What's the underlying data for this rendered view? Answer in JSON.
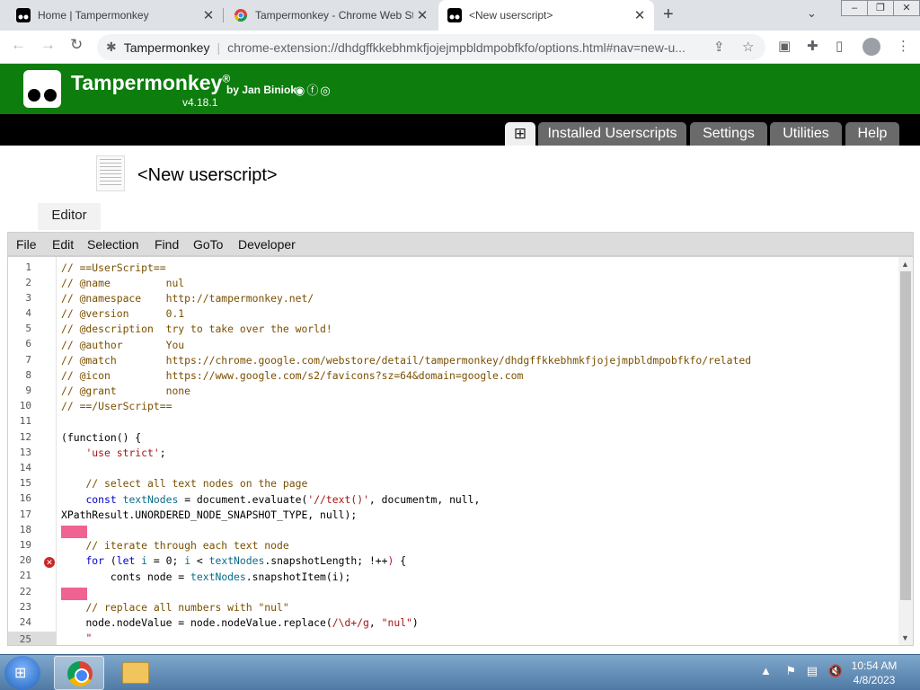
{
  "browser": {
    "tabs": [
      {
        "title": "Home | Tampermonkey",
        "active": false
      },
      {
        "title": "Tampermonkey - Chrome Web St",
        "active": false
      },
      {
        "title": "<New userscript>",
        "active": true
      }
    ],
    "site_name": "Tampermonkey",
    "url": "chrome-extension://dhdgffkkebhmkfjojejmpbldmpobfkfo/options.html#nav=new-u..."
  },
  "tm": {
    "name": "Tampermonkey",
    "reg": "®",
    "by": "by Jan Biniok",
    "version": "v4.18.1",
    "nav": {
      "add_icon": "⊞",
      "installed": "Installed Userscripts",
      "settings": "Settings",
      "utilities": "Utilities",
      "help": "Help"
    }
  },
  "script": {
    "title": "<New userscript>",
    "editor_tab": "Editor"
  },
  "menu": [
    "File",
    "Edit",
    "Selection",
    "Find",
    "GoTo",
    "Developer"
  ],
  "code": {
    "line_numbers": [
      "1",
      "2",
      "3",
      "4",
      "5",
      "6",
      "7",
      "8",
      "9",
      "10",
      "11",
      "12",
      "13",
      "14",
      "15",
      "16",
      "17",
      "18",
      "19",
      "20",
      "21",
      "22",
      "23",
      "24",
      "25"
    ],
    "error_line": "20",
    "lines": {
      "l1": "// ==UserScript==",
      "l2": "// @name         nul",
      "l3": "// @namespace    http://tampermonkey.net/",
      "l4": "// @version      0.1",
      "l5": "// @description  try to take over the world!",
      "l6": "// @author       You",
      "l7": "// @match        https://chrome.google.com/webstore/detail/tampermonkey/dhdgffkkebhmkfjojejmpbldmpobfkfo/related",
      "l8": "// @icon         https://www.google.com/s2/favicons?sz=64&domain=google.com",
      "l9": "// @grant        none",
      "l10": "// ==/UserScript==",
      "l12": "(function() {",
      "l13_str": "'use strict'",
      "l15": "// select all text nodes on the page",
      "l16_kw": "const",
      "l16_var": "textNodes",
      "l16_a": "= document.evaluate(",
      "l16_str": "'//text()'",
      "l16_b": ", documentm, null,",
      "l17": "XPathResult.UNORDERED_NODE_SNAPSHOT_TYPE, null);",
      "l19": "// iterate through each text node",
      "l20_kw1": "for",
      "l20_a": "(",
      "l20_kw2": "let",
      "l20_var1": "i",
      "l20_b": "= 0;",
      "l20_var2": "i",
      "l20_c": "<",
      "l20_var3": "textNodes",
      "l20_d": ".snapshotLength; !++",
      "l20_err": ")",
      "l20_e": "{",
      "l21_a": "conts node =",
      "l21_var": "textNodes",
      "l21_b": ".snapshotItem(i);",
      "l23": "// replace all numbers with \"nul\"",
      "l24_a": "node.nodeValue = node.nodeValue.replace(",
      "l24_str": "/\\d+/g",
      "l24_b": ",",
      "l24_str2": "\"nul\"",
      "l24_c": ")",
      "l25": "\""
    }
  },
  "taskbar": {
    "time": "10:54 AM",
    "date": "4/8/2023"
  },
  "colors": {
    "tm_green": "#0d7d0e",
    "nav_tab": "#6a6a6a",
    "error": "#c62828",
    "pink_highlight": "#f06292"
  },
  "icons": [
    "back-arrow-icon",
    "forward-arrow-icon",
    "reload-icon",
    "extension-icon",
    "share-icon",
    "star-icon",
    "puzzle-icon",
    "sidebar-icon",
    "profile-icon",
    "kebab-menu-icon",
    "github-icon",
    "facebook-icon",
    "instagram-icon",
    "error-icon",
    "windows-start-icon",
    "chrome-icon",
    "folder-icon"
  ]
}
